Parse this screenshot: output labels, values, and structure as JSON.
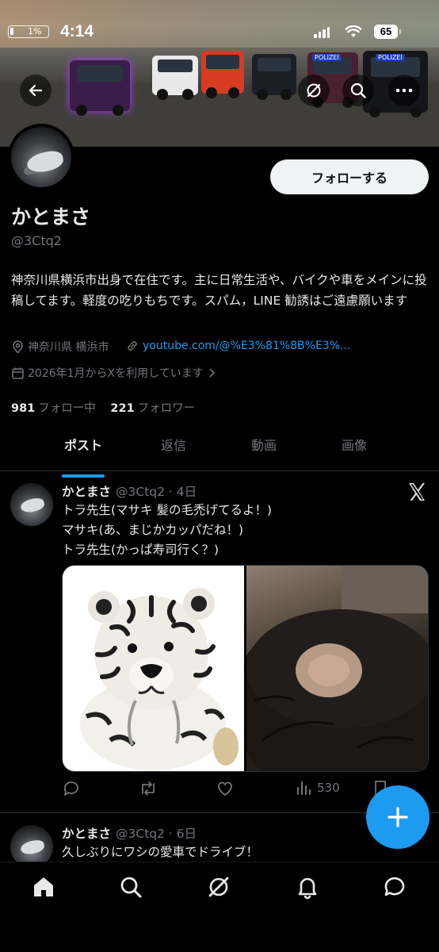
{
  "status_bar": {
    "left_battery": "1%",
    "time": "4:14",
    "battery": "65"
  },
  "banner": {
    "sign_1": "POLIZEI",
    "sign_2": "POLIZEI"
  },
  "profile": {
    "follow_label": "フォローする",
    "display_name": "かとまさ",
    "handle": "@3Ctq2",
    "bio": "神奈川県横浜市出身で在住です。主に日常生活や、バイクや車をメインに投稿してます。軽度の吃りもちです。スパム，LINE 勧誘はご遠慮願います",
    "location": "神奈川県 横浜市",
    "link": "youtube.com/@%E3%81%8B%E3%...",
    "joined": "2026年1月からXを利用しています",
    "following_count": "981",
    "following_label": "フォロー中",
    "followers_count": "221",
    "followers_label": "フォロワー"
  },
  "tabs": [
    "ポスト",
    "返信",
    "動画",
    "画像"
  ],
  "posts": [
    {
      "name": "かとまさ",
      "meta": "@3Ctq2 · 4日",
      "lines": [
        "トラ先生(マサキ 髪の毛禿げてるよ！)",
        "マサキ(あ、まじかカッパだね！)",
        "トラ先生(かっぱ寿司行く？)"
      ],
      "views": "530"
    },
    {
      "name": "かとまさ",
      "meta": "@3Ctq2 · 6日",
      "lines": [
        "久しぶりにワシの愛車でドライブ！"
      ]
    }
  ],
  "colors": {
    "accent": "#1d9bf0",
    "background": "#000000",
    "secondary_text": "#71767b"
  }
}
